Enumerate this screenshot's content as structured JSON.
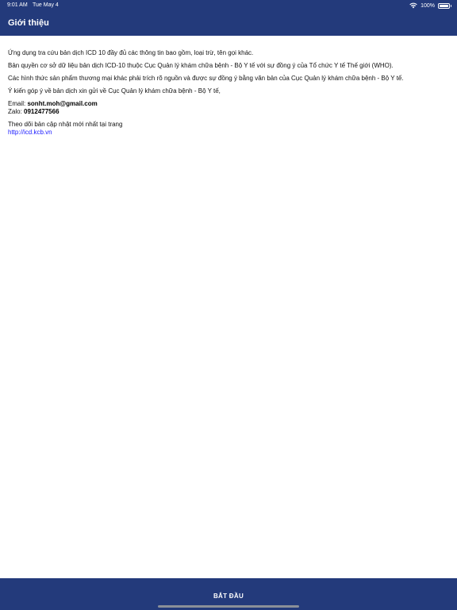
{
  "status_bar": {
    "time": "9:01 AM",
    "date": "Tue May 4",
    "battery": "100%",
    "battery_level": 1.0
  },
  "header": {
    "title": "Giới thiệu"
  },
  "content": {
    "paragraphs": [
      "Ứng dụng tra cứu bản dịch ICD 10 đầy đủ các thông tin bao gồm, loại trừ, tên gọi khác.",
      "Bản quyền cơ sở dữ liệu bản dịch ICD-10 thuộc Cục Quản lý khám chữa bệnh - Bộ Y tế với sự đồng ý của Tổ chức Y tế Thế giới (WHO).",
      "Các hình thức sản phẩm thương mại khác phải trích rõ nguồn và được sự đồng ý bằng văn bản của Cục Quản lý khám chữa bệnh - Bộ Y tế.",
      "Ý kiến góp ý về bản dịch xin gửi về Cục Quản lý khám chữa bệnh - Bộ Y tế,"
    ],
    "email_label": "Email:",
    "email_value": "sonht.moh@gmail.com",
    "zalo_label": "Zalo:",
    "zalo_value": "0912477566",
    "follow_text": "Theo dõi bản cập nhật mới nhất tại trang",
    "link_text": "http://icd.kcb.vn"
  },
  "footer": {
    "start_label": "BẮT ĐẦU"
  }
}
